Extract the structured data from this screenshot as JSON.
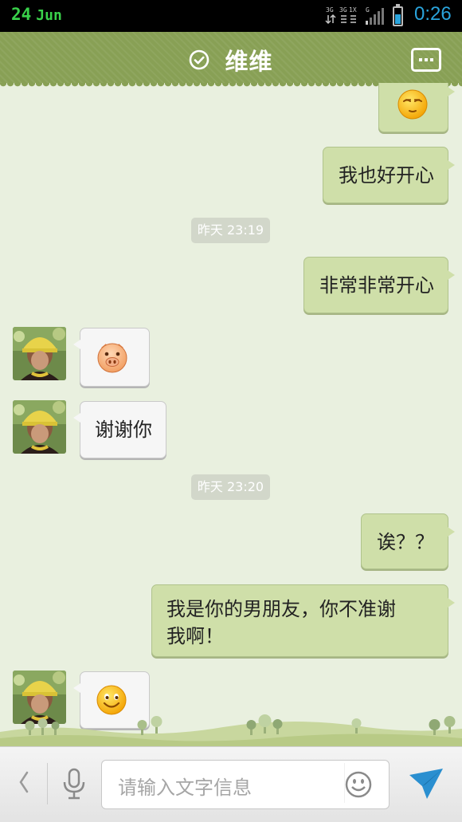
{
  "status_bar": {
    "date_day": "24",
    "date_month": "Jun",
    "time": "0:26",
    "date_color": "#39d14a",
    "time_color": "#2aa4dc"
  },
  "header": {
    "contact_name": "维维",
    "background_color": "#88a055",
    "verified_icon": "check-circle-icon",
    "more_icon": "more-dots-icon"
  },
  "messages": [
    {
      "side": "right",
      "type": "emoji",
      "icon": "sleepy-face-icon"
    },
    {
      "side": "right",
      "type": "text",
      "text": "我也好开心"
    },
    {
      "type": "time",
      "text": "昨天 23:19"
    },
    {
      "side": "right",
      "type": "text",
      "text": "非常非常开心"
    },
    {
      "side": "left",
      "type": "emoji",
      "icon": "pig-face-icon"
    },
    {
      "side": "left",
      "type": "text",
      "text": "谢谢你"
    },
    {
      "type": "time",
      "text": "昨天 23:20"
    },
    {
      "side": "right",
      "type": "text",
      "text": "诶？？"
    },
    {
      "side": "right",
      "type": "text",
      "text_line1": "我是你的男朋友，你不准谢",
      "text_line2": "我啊！"
    },
    {
      "side": "left",
      "type": "emoji",
      "icon": "smiley-face-icon"
    }
  ],
  "input_bar": {
    "placeholder": "请输入文字信息",
    "back_icon": "chevron-left-icon",
    "mic_icon": "microphone-icon",
    "emoji_icon": "smiley-icon",
    "send_icon": "send-icon"
  },
  "colors": {
    "background": "#e9f0df",
    "outgoing_bubble": "#cfdfa9",
    "incoming_bubble": "#f6f6f6",
    "accent_blue": "#2aa4dc"
  }
}
